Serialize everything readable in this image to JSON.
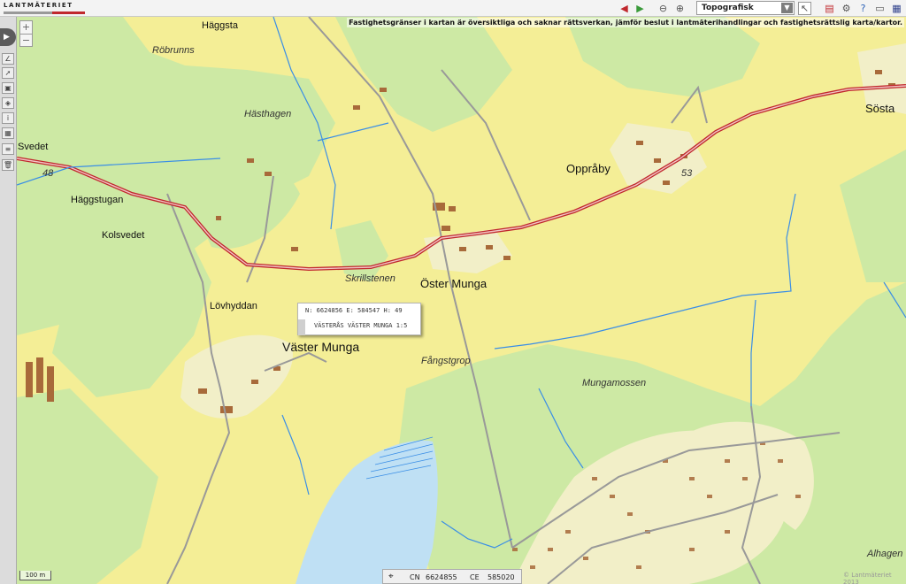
{
  "header": {
    "logo": "LANTMÄTERIET",
    "map_type": "Topografisk"
  },
  "notice": "Fastighetsgränser i kartan är översiktliga och saknar rättsverkan, jämför beslut i lantmäterihandlingar och fastighetsrättslig karta/kartor.",
  "places": {
    "haggsta": "Häggsta",
    "robrunns": "Röbrunns",
    "hasthagen": "Hästhagen",
    "svedet": "Svedet",
    "road48": "48",
    "haggstugan": "Häggstugan",
    "kolsvedet": "Kolsvedet",
    "lovhyddan": "Lövhyddan",
    "vaster_munga": "Väster Munga",
    "skrillstenen": "Skrillstenen",
    "oster_munga": "Öster Munga",
    "fangstgrop": "Fångstgrop",
    "oppraby": "Oppråby",
    "road53": "53",
    "sosta": "Sösta",
    "mungamossen": "Mungamossen",
    "alhagen": "Alhagen"
  },
  "popup": {
    "coords": "N: 6624856 E: 584547 H: 49",
    "name": "VÄSTERÅS VÄSTER MUNGA 1:5"
  },
  "scale_label": "100 m",
  "coordinates": {
    "n_label": "CN",
    "n_value": "6624855",
    "e_label": "CE",
    "e_value": "585020"
  },
  "copyright": "© Lantmäteriet 2013",
  "colors": {
    "field": "#f4ee96",
    "forest": "#cde9a4",
    "water": "#bfe0f4",
    "road": "#c0282d",
    "stream": "#3a8ee6"
  }
}
